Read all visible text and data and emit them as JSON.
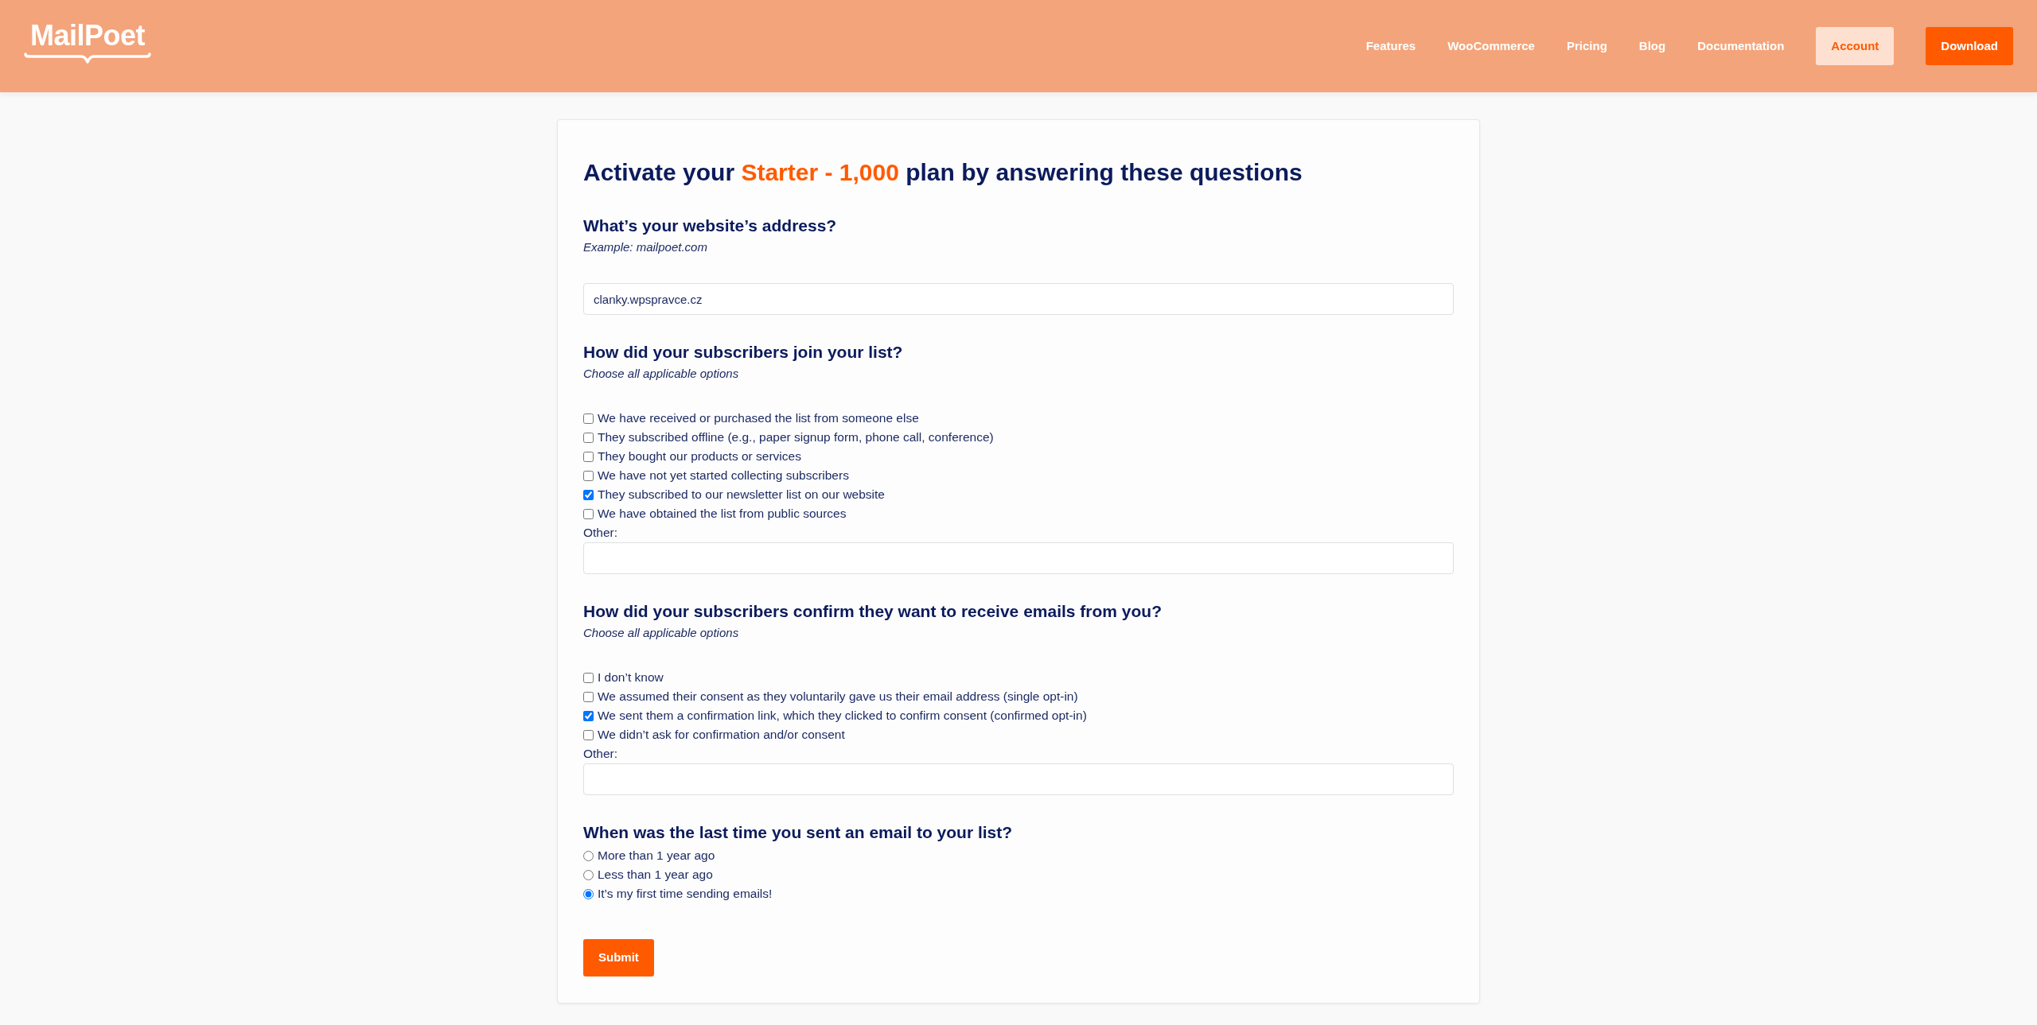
{
  "header": {
    "logo": "MailPoet",
    "nav": [
      {
        "label": "Features"
      },
      {
        "label": "WooCommerce"
      },
      {
        "label": "Pricing"
      },
      {
        "label": "Blog"
      },
      {
        "label": "Documentation"
      }
    ],
    "buttons": [
      {
        "label": "Account",
        "kind": "secondary"
      },
      {
        "label": "Download",
        "kind": "primary"
      }
    ]
  },
  "form": {
    "title": [
      {
        "text": "Activate your ",
        "highlight": false
      },
      {
        "text": "Starter - 1,000",
        "highlight": true
      },
      {
        "text": " plan by answering these questions",
        "highlight": false
      }
    ],
    "questions": [
      {
        "kind": "text",
        "heading": "What’s your website’s address?",
        "hint": "Example: mailpoet.com",
        "value": "clanky.wpspravce.cz"
      },
      {
        "kind": "checkboxes",
        "heading": "How did your subscribers join your list?",
        "hint": "Choose all applicable options",
        "options": [
          {
            "label": "We have received or purchased the list from someone else",
            "checked": false
          },
          {
            "label": "They subscribed offline (e.g., paper signup form, phone call, conference)",
            "checked": false
          },
          {
            "label": "They bought our products or services",
            "checked": false
          },
          {
            "label": "We have not yet started collecting subscribers",
            "checked": false
          },
          {
            "label": "They subscribed to our newsletter list on our website",
            "checked": true
          },
          {
            "label": "We have obtained the list from public sources",
            "checked": false
          }
        ],
        "other_label": "Other:"
      },
      {
        "kind": "checkboxes",
        "heading": "How did your subscribers confirm they want to receive emails from you?",
        "hint": "Choose all applicable options",
        "options": [
          {
            "label": "I don’t know",
            "checked": false
          },
          {
            "label": "We assumed their consent as they voluntarily gave us their email address (single opt-in)",
            "checked": false
          },
          {
            "label": "We sent them a confirmation link, which they clicked to confirm consent (confirmed opt-in)",
            "checked": true
          },
          {
            "label": "We didn’t ask for confirmation and/or consent",
            "checked": false
          }
        ],
        "other_label": "Other:"
      },
      {
        "kind": "radios",
        "heading": "When was the last time you sent an email to your list?",
        "options": [
          {
            "label": "More than 1 year ago",
            "selected": false
          },
          {
            "label": "Less than 1 year ago",
            "selected": false
          },
          {
            "label": "It’s my first time sending emails!",
            "selected": true
          }
        ]
      }
    ],
    "submit": "Submit"
  }
}
